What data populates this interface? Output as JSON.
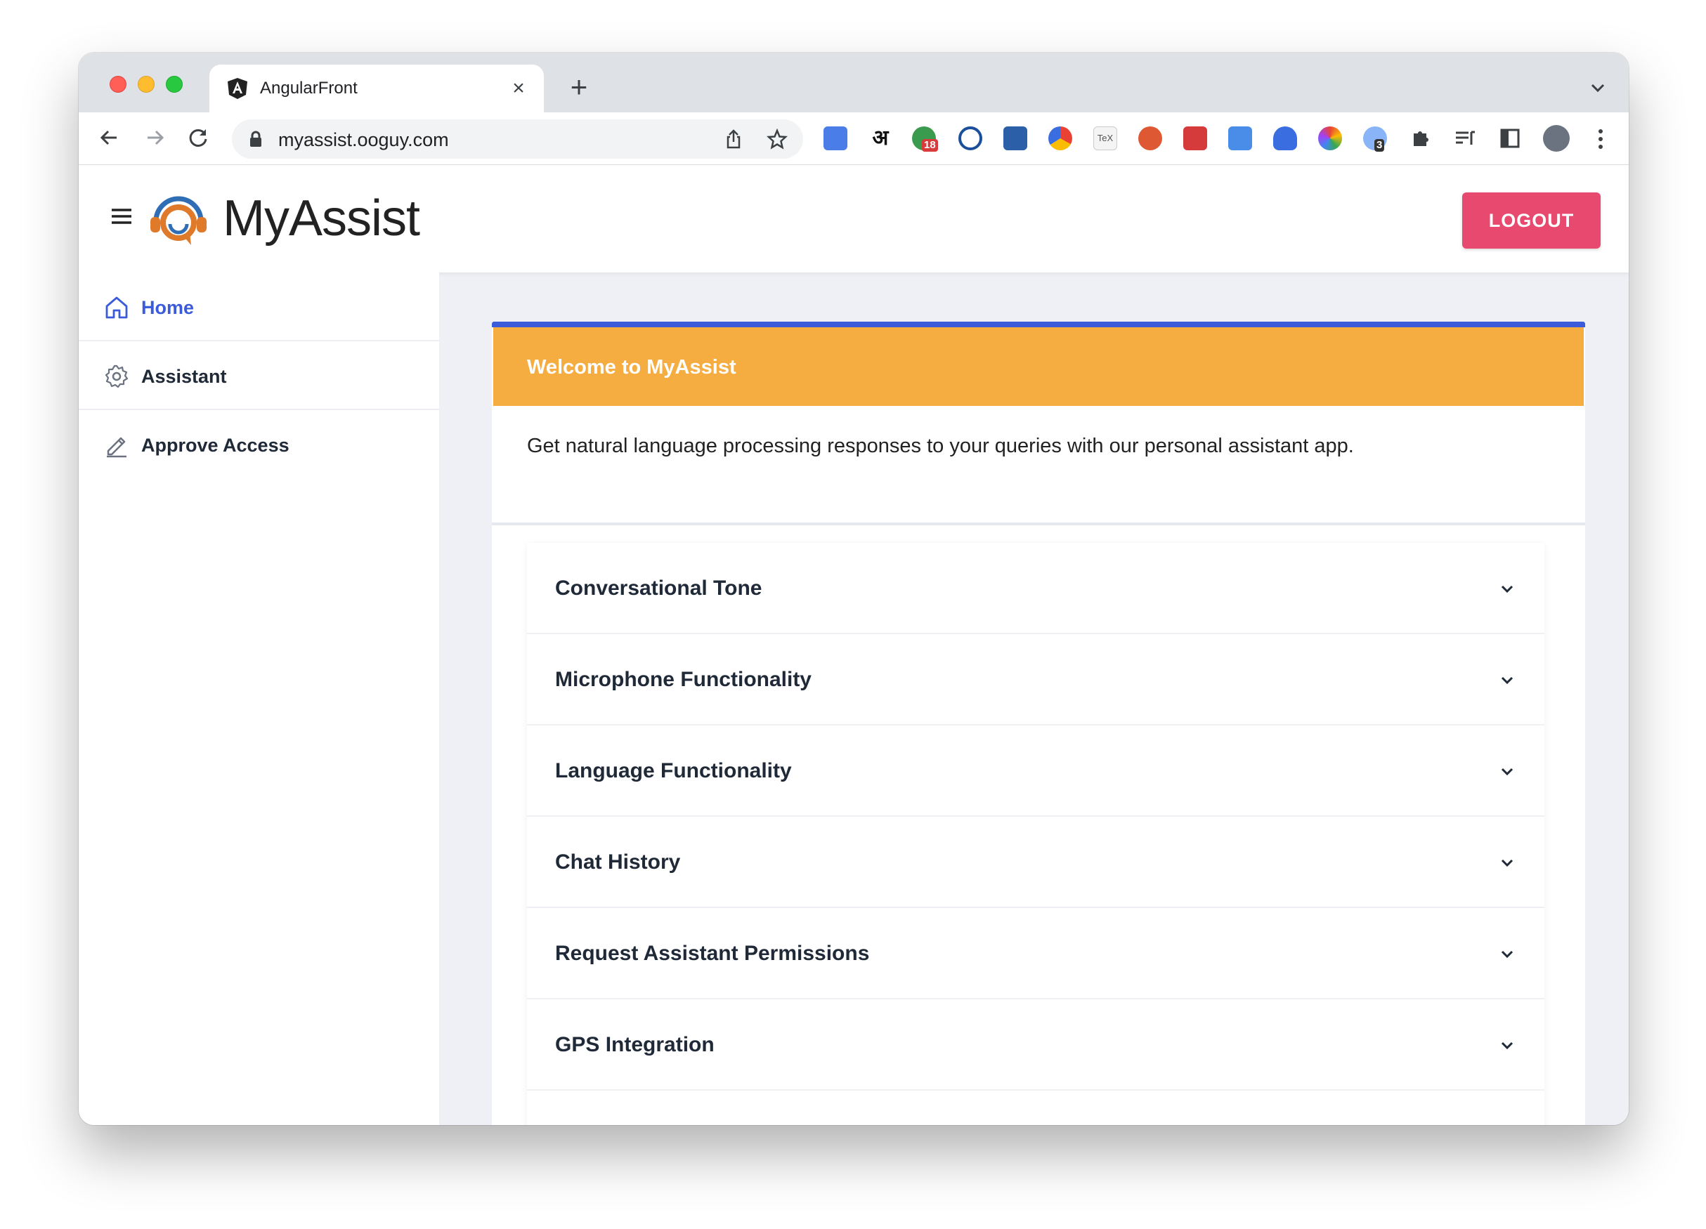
{
  "browser": {
    "tab_title": "AngularFront",
    "url": "myassist.ooguy.com",
    "extension_badges": [
      "18",
      "3"
    ],
    "hindi_ext_label": "अ",
    "tex_ext_label": "TeX"
  },
  "header": {
    "logo_text": "MyAssist",
    "logout_label": "LOGOUT"
  },
  "sidebar": {
    "items": [
      {
        "label": "Home",
        "icon": "home-icon",
        "active": true
      },
      {
        "label": "Assistant",
        "icon": "gear-icon",
        "active": false
      },
      {
        "label": "Approve Access",
        "icon": "pencil-icon",
        "active": false
      }
    ]
  },
  "main": {
    "welcome_title": "Welcome to MyAssist",
    "description": "Get natural language processing responses to your queries with our personal assistant app.",
    "accordion": [
      {
        "title": "Conversational Tone"
      },
      {
        "title": "Microphone Functionality"
      },
      {
        "title": "Language Functionality"
      },
      {
        "title": "Chat History"
      },
      {
        "title": "Request Assistant Permissions"
      },
      {
        "title": "GPS Integration"
      }
    ]
  },
  "colors": {
    "accent_blue": "#3b5bdb",
    "header_orange": "#f5ad41",
    "logout_pink": "#e84a6f"
  }
}
